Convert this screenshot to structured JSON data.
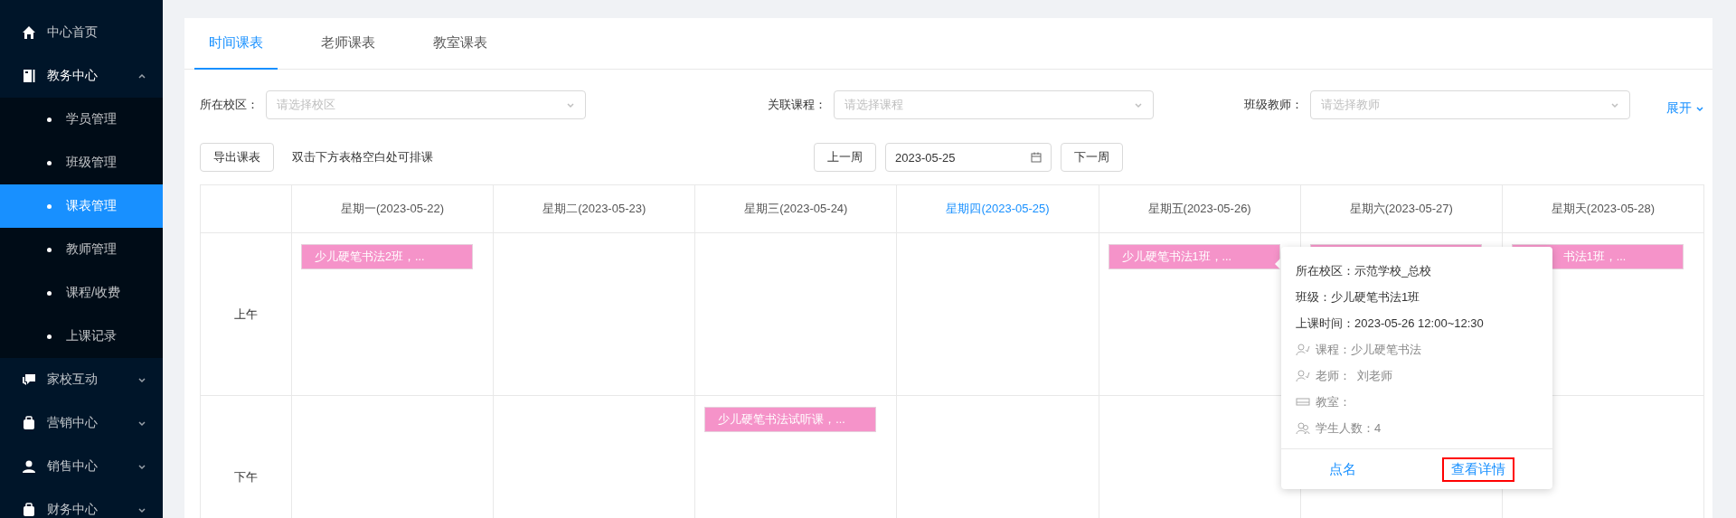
{
  "sidebar": {
    "items": [
      {
        "label": "中心首页",
        "expanded": false
      },
      {
        "label": "教务中心",
        "expanded": true,
        "children": [
          {
            "label": "学员管理",
            "selected": false
          },
          {
            "label": "班级管理",
            "selected": false
          },
          {
            "label": "课表管理",
            "selected": true
          },
          {
            "label": "教师管理",
            "selected": false
          },
          {
            "label": "课程/收费",
            "selected": false
          },
          {
            "label": "上课记录",
            "selected": false
          }
        ]
      },
      {
        "label": "家校互动",
        "expanded": false
      },
      {
        "label": "营销中心",
        "expanded": false
      },
      {
        "label": "销售中心",
        "expanded": false
      },
      {
        "label": "财务中心",
        "expanded": false
      }
    ]
  },
  "tabs": [
    {
      "label": "时间课表",
      "selected": true
    },
    {
      "label": "老师课表",
      "selected": false
    },
    {
      "label": "教室课表",
      "selected": false
    }
  ],
  "filters": [
    {
      "label": "所在校区：",
      "placeholder": "请选择校区"
    },
    {
      "label": "关联课程：",
      "placeholder": "请选择课程"
    },
    {
      "label": "班级教师：",
      "placeholder": "请选择教师"
    }
  ],
  "expand_link": "展开",
  "toolbar": {
    "export_button": "导出课表",
    "hint": "双击下方表格空白处可排课",
    "prev_button": "上一周",
    "date": "2023-05-25",
    "next_button": "下一周"
  },
  "schedule": {
    "days": [
      {
        "label": "星期一(2023-05-22)",
        "today": false
      },
      {
        "label": "星期二(2023-05-23)",
        "today": false
      },
      {
        "label": "星期三(2023-05-24)",
        "today": false
      },
      {
        "label": "星期四(2023-05-25)",
        "today": true
      },
      {
        "label": "星期五(2023-05-26)",
        "today": false
      },
      {
        "label": "星期六(2023-05-27)",
        "today": false
      },
      {
        "label": "星期天(2023-05-28)",
        "today": false
      }
    ],
    "rows": [
      {
        "label": "上午",
        "cells": [
          {
            "events": [
              {
                "kind": "full",
                "text": "少儿硬笔书法2班，..."
              }
            ]
          },
          {},
          {},
          {},
          {
            "events": [
              {
                "kind": "full",
                "text": "少儿硬笔书法1班，..."
              }
            ]
          },
          {
            "events": [
              {
                "kind": "covered"
              }
            ]
          },
          {
            "events": [
              {
                "kind": "partial",
                "text": "书法1班，..."
              }
            ]
          }
        ]
      },
      {
        "label": "下午",
        "cells": [
          {},
          {},
          {
            "events": [
              {
                "kind": "full",
                "text": "少儿硬笔书法试听课，..."
              }
            ]
          },
          {},
          {},
          {},
          {}
        ]
      }
    ]
  },
  "popover": {
    "lines": [
      {
        "kind": "plain",
        "text": "所在校区：示范学校_总校"
      },
      {
        "kind": "plain",
        "text": "班级：少儿硬笔书法1班"
      },
      {
        "kind": "plain",
        "text": "上课时间：2023-05-26 12:00~12:30"
      },
      {
        "kind": "teacher",
        "text": "课程：少儿硬笔书法"
      },
      {
        "kind": "teacher",
        "text": "老师：  刘老师"
      },
      {
        "kind": "room",
        "text": "教室："
      },
      {
        "kind": "students",
        "text": "学生人数：4"
      }
    ],
    "actions": [
      {
        "label": "点名",
        "highlighted": false
      },
      {
        "label": "查看详情",
        "highlighted": true
      }
    ]
  }
}
